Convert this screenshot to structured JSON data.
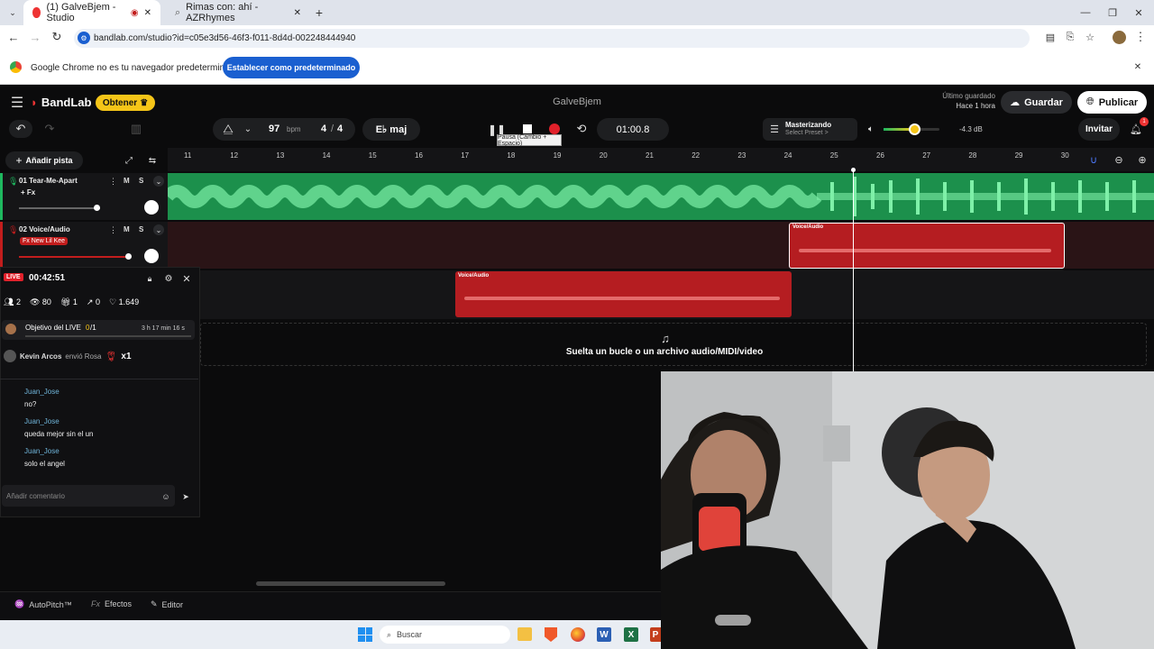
{
  "browser": {
    "tabs": [
      {
        "title": "(1) GalveBjem - Studio"
      },
      {
        "title": "Rimas con: ahí - AZRhymes"
      }
    ],
    "new_tab": "+",
    "url": "bandlab.com/studio?id=c05e3d56-46f3-f011-8d4d-002248444940",
    "infobar_text": "Google Chrome no es tu navegador predeterminado",
    "infobar_button": "Establecer como predeterminado"
  },
  "app": {
    "logo": "BandLab",
    "get_button": "Obtener",
    "project_title": "GalveBjem",
    "last_saved_label": "Último guardado",
    "last_saved_value": "Hace 1 hora",
    "save_button": "Guardar",
    "publish_button": "Publicar",
    "bpm": "97",
    "bpm_unit": "bpm",
    "time_signature_num": "4",
    "time_signature_sep": "/",
    "time_signature_den": "4",
    "key": "E♭ maj",
    "time_display": "01:00.8",
    "mastering_label": "Masterizando",
    "mastering_preset": "Select Preset >",
    "master_volume_db": "-4.3 dB",
    "invite_button": "Invitar",
    "notification_count": "1",
    "tooltip": "Pausa (Cambio + Espacio)",
    "add_track": "Añadir pista",
    "ruler": [
      "11",
      "12",
      "13",
      "14",
      "15",
      "16",
      "17",
      "18",
      "19",
      "20",
      "21",
      "22",
      "23",
      "24",
      "25",
      "26",
      "27",
      "28",
      "29",
      "30"
    ],
    "tracks": [
      {
        "name": "01  Tear-Me-Apart",
        "fx": "+ Fx",
        "m": "M",
        "s": "S"
      },
      {
        "name": "02  Voice/Audio",
        "fx": "Fx New Lil Kee",
        "m": "M",
        "s": "S"
      }
    ],
    "clips": [
      {
        "label": "Voice/Audio"
      },
      {
        "label": "Voice/Audio"
      }
    ],
    "drop_hint": "Suelta un bucle o un archivo audio/MIDI/video",
    "bottom_tools": [
      "AutoPitch™",
      "Efectos",
      "Editor"
    ],
    "bottom_prefix_fx": "Fx"
  },
  "live": {
    "badge": "LIVE",
    "timer": "00:42:51",
    "stats": [
      {
        "icon": "people-icon",
        "value": "2"
      },
      {
        "icon": "eye-icon",
        "value": "80"
      },
      {
        "icon": "gift-icon",
        "value": "1"
      },
      {
        "icon": "share-icon",
        "value": "0"
      },
      {
        "icon": "heart-icon",
        "value": "1.649"
      }
    ],
    "goal_label": "Objetivo del LIVE",
    "goal_current": "0",
    "goal_total": "/1",
    "goal_time": "3 h 17 min 16 s",
    "gift_sender": "Kevin Arcos",
    "gift_text": "envió Rosa",
    "gift_count": "x1",
    "comments": [
      {
        "user": "Juan_Jose",
        "text": "no?"
      },
      {
        "user": "Juan_Jose",
        "text": "queda mejor sin el un"
      },
      {
        "user": "Juan_Jose",
        "text": "solo el angel"
      }
    ],
    "comment_placeholder": "Añadir comentario"
  },
  "taskbar": {
    "search_placeholder": "Buscar"
  },
  "colors": {
    "track1": "#1eb85f",
    "track2": "#c21d1d",
    "accent_yellow": "#f5c518",
    "primary_blue": "#1a5fd0"
  }
}
